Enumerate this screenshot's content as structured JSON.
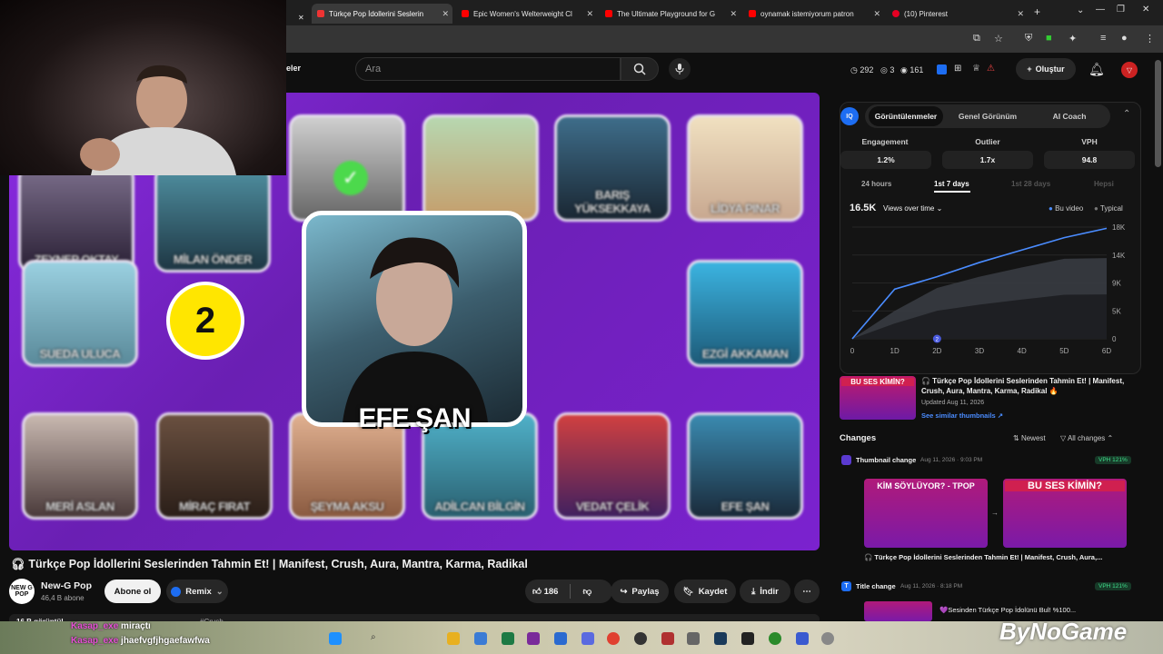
{
  "browser": {
    "tabs": [
      {
        "label": "Türkçe Pop İdollerini Seslerin",
        "active": true,
        "favicon": "headphones-icon"
      },
      {
        "label": "Epic Women's Welterweight Cl",
        "active": false,
        "favicon": "youtube-icon"
      },
      {
        "label": "The Ultimate Playground for G",
        "active": false,
        "favicon": "youtube-icon"
      },
      {
        "label": "oynamak istemiyorum patron",
        "active": false,
        "favicon": "youtube-icon"
      },
      {
        "label": "(10) Pinterest",
        "active": false,
        "favicon": "pinterest-icon"
      }
    ]
  },
  "header": {
    "search_placeholder": "Ara",
    "nav_partial": "eler",
    "stats": {
      "views_ring": "292",
      "eye1": "3",
      "eye2": "161"
    },
    "create_label": "Oluştur"
  },
  "video": {
    "title": "Türkçe Pop İdollerini Seslerinden Tahmin Et! | Manifest, Crush, Aura, Mantra, Karma, Radikal",
    "featured_name": "EFE ŞAN",
    "badge_number": "2",
    "cards": [
      "ZEYNEP OKTAY",
      "MİLAN ÖNDER",
      "BARIŞ YÜKSEKKAYA",
      "LİDYA PINAR",
      "SUEDA ULUCA",
      "EZGİ AKKAMAN",
      "MERİ ASLAN",
      "MİRAÇ FIRAT",
      "ŞEYMA AKSU",
      "ADİLCAN BİLGİN",
      "VEDAT ÇELİK",
      "EFE ŞAN"
    ]
  },
  "channel": {
    "name": "New-G Pop",
    "avatar_text": "NEW G POP",
    "subscribers": "46,4 B abone",
    "subscribe_label": "Abone ol",
    "remix_label": "Remix"
  },
  "actions": {
    "likes": "186",
    "share": "Paylaş",
    "save": "Kaydet",
    "download": "İndir"
  },
  "below": {
    "views_partial": "16 B görüntül",
    "desc_partial": "#Crush"
  },
  "vidiq": {
    "tabs": [
      "Görüntülenmeler",
      "Genel Görünüm",
      "AI Coach"
    ],
    "metrics": [
      {
        "label": "Engagement",
        "value": "1.2%"
      },
      {
        "label": "Outlier",
        "value": "1.7x"
      },
      {
        "label": "VPH",
        "value": "94.8"
      }
    ],
    "ranges": [
      "24 hours",
      "1st 7 days",
      "1st 28 days",
      "Hepsi"
    ],
    "total": "16.5K",
    "dropdown": "Views over time",
    "legend_this": "Bu video",
    "legend_typical": "Typical",
    "marker": "2",
    "thumb_text": "BU SES KİMİN?",
    "thumb_title": "🎧 Türkçe Pop İdollerini Seslerinden Tahmin Et! | Manifest, Crush, Aura, Mantra, Karma, Radikal 🔥",
    "updated": "Updated Aug 11, 2026",
    "see_similar": "See similar thumbnails ↗"
  },
  "changes": {
    "heading": "Changes",
    "sort": "Newest",
    "filter": "All changes",
    "items": [
      {
        "type": "Thumbnail change",
        "date": "Aug 11, 2026 · 9:03 PM",
        "badge": "VPH 121%",
        "old_text": "KİM SÖYLÜYOR? - TPOP",
        "new_text": "BU SES KİMİN?",
        "caption": "🎧 Türkçe Pop İdollerini Seslerinden Tahmin Et! | Manifest, Crush, Aura,..."
      },
      {
        "type": "Title change",
        "date": "Aug 11, 2026 · 8:18 PM",
        "badge": "VPH 121%",
        "caption": "💜Sesinden Türkçe Pop İdolünü Bul! %100..."
      }
    ]
  },
  "chart_data": {
    "type": "area",
    "x": [
      "0",
      "1D",
      "2D",
      "3D",
      "4D",
      "5D",
      "6D"
    ],
    "series": [
      {
        "name": "Bu video",
        "values": [
          0,
          8000,
          10000,
          12300,
          14300,
          16300,
          17800
        ]
      },
      {
        "name": "Typical",
        "values": [
          0,
          4500,
          8200,
          10000,
          11500,
          12900,
          13000
        ]
      }
    ],
    "yticks": [
      "0",
      "5K",
      "9K",
      "14K",
      "18K"
    ],
    "ylim": [
      0,
      18000
    ],
    "colors": {
      "this": "#4a8cff",
      "typical": "#555a63"
    }
  },
  "overlay": {
    "chat": [
      {
        "user": "Kasap_exe",
        "msg": "miraçtı"
      },
      {
        "user": "Kasap_exe",
        "msg": "jhaefvgfjhgaefawfwa"
      }
    ],
    "watermark": "ByNoGame"
  }
}
